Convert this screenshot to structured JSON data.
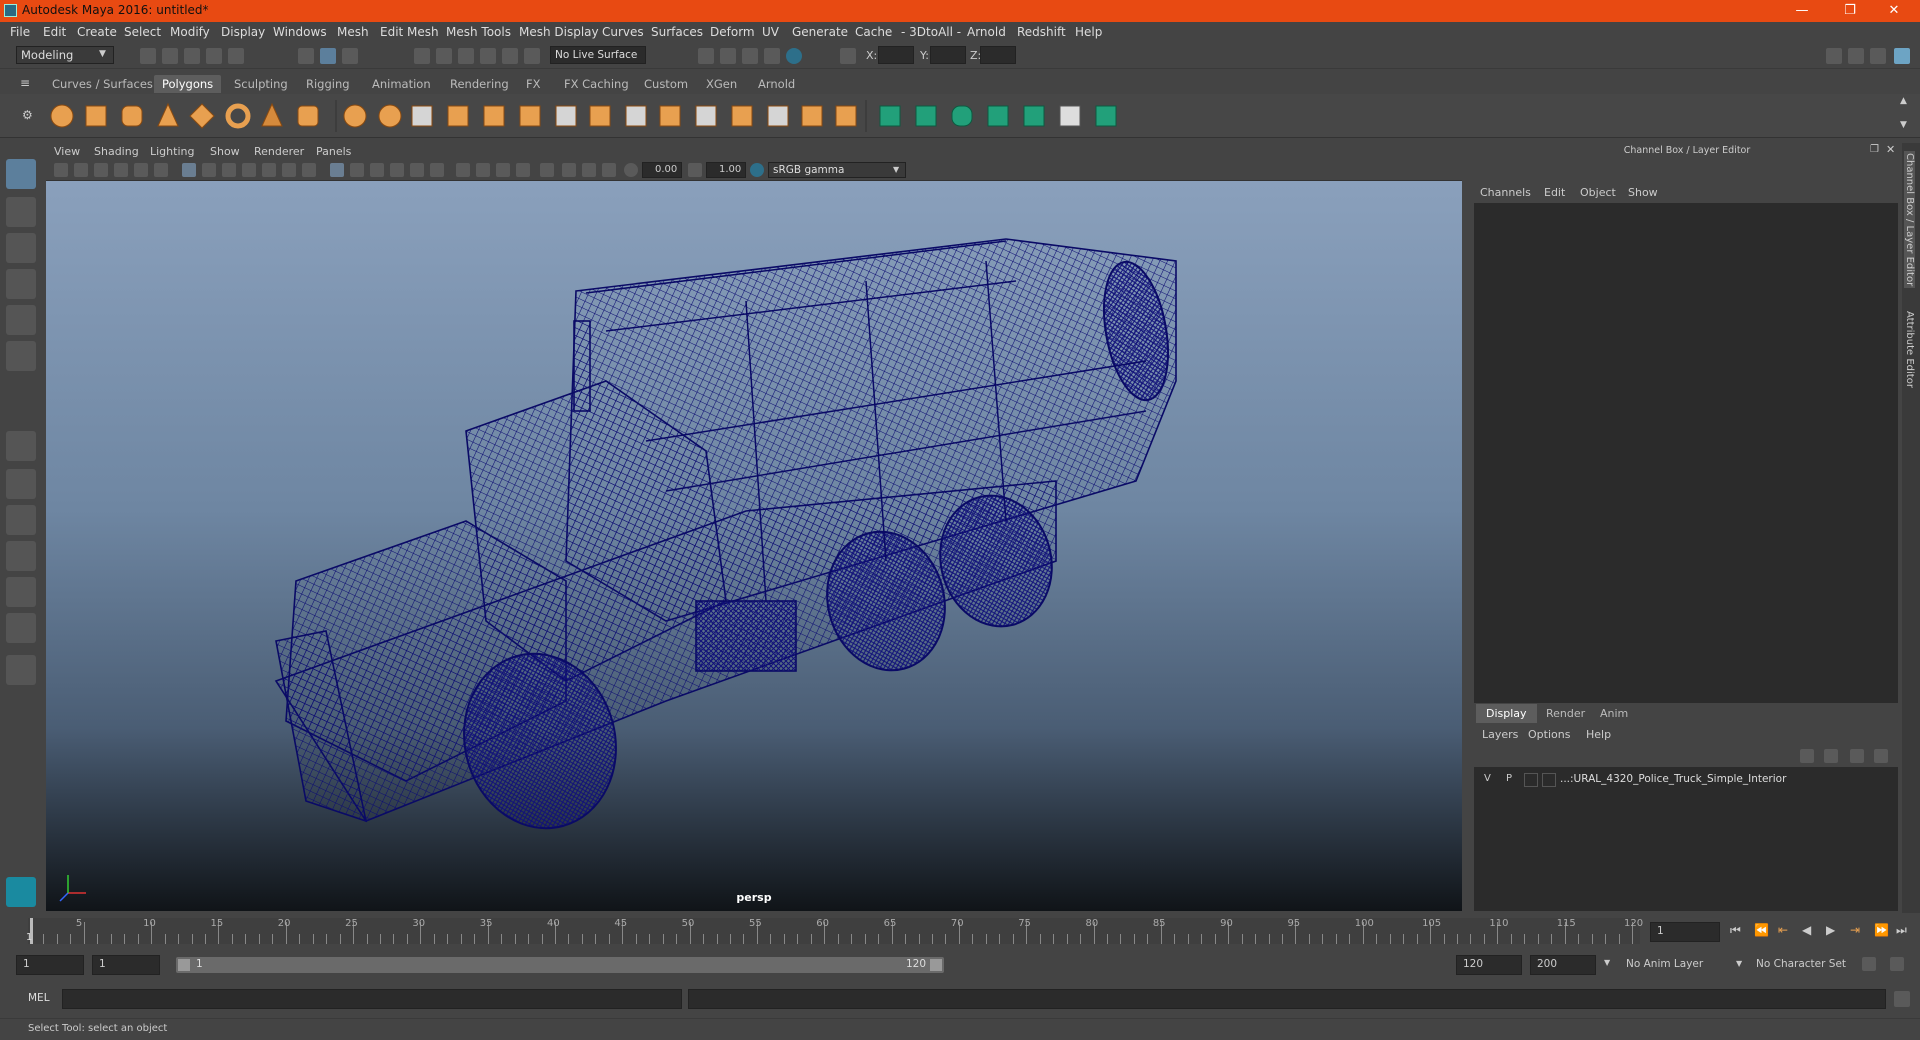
{
  "window": {
    "title": "Autodesk Maya 2016: untitled*",
    "minimize": "—",
    "restore": "❐",
    "close": "✕"
  },
  "menubar": [
    "File",
    "Edit",
    "Create",
    "Select",
    "Modify",
    "Display",
    "Windows",
    "Mesh",
    "Edit Mesh",
    "Mesh Tools",
    "Mesh Display",
    "Curves",
    "Surfaces",
    "Deform",
    "UV",
    "Generate",
    "Cache",
    "- 3DtoAll -",
    "Arnold",
    "Redshift",
    "Help"
  ],
  "statusline": {
    "mode": "Modeling",
    "live_surface": "No Live Surface",
    "x_label": "X:",
    "y_label": "Y:",
    "z_label": "Z:"
  },
  "shelf_tabs": [
    "Curves / Surfaces",
    "Polygons",
    "Sculpting",
    "Rigging",
    "Animation",
    "Rendering",
    "FX",
    "FX Caching",
    "Custom",
    "XGen",
    "Arnold"
  ],
  "shelf_active": "Polygons",
  "viewport": {
    "menu": [
      "View",
      "Shading",
      "Lighting",
      "Show",
      "Renderer",
      "Panels"
    ],
    "exposure": "0.00",
    "gamma": "1.00",
    "color_space": "sRGB gamma",
    "camera_label": "persp"
  },
  "channel_box": {
    "title": "Channel Box / Layer Editor",
    "menu": [
      "Channels",
      "Edit",
      "Object",
      "Show"
    ]
  },
  "layer_editor": {
    "tabs": [
      "Display",
      "Render",
      "Anim"
    ],
    "active_tab": "Display",
    "menu": [
      "Layers",
      "Options",
      "Help"
    ],
    "layers": [
      {
        "v": "V",
        "p": "P",
        "name": "...:URAL_4320_Police_Truck_Simple_Interior"
      }
    ]
  },
  "side_tabs": [
    "Channel Box / Layer Editor",
    "Attribute Editor"
  ],
  "timeline": {
    "ticks": [
      5,
      10,
      15,
      20,
      25,
      30,
      35,
      40,
      45,
      50,
      55,
      60,
      65,
      70,
      75,
      80,
      85,
      90,
      95,
      100,
      105,
      110,
      115,
      120
    ],
    "start_label": "1",
    "current_frame": "1"
  },
  "range": {
    "start": "1",
    "playback_start": "1",
    "slider_start": "1",
    "slider_end": "120",
    "playback_end": "120",
    "end": "200",
    "anim_layer": "No Anim Layer",
    "char_set": "No Character Set"
  },
  "mel": {
    "label": "MEL"
  },
  "help_line": "Select Tool: select an object",
  "colors": {
    "titlebar": "#e84a12",
    "wireframe": "#14147a",
    "accent": "#e8a050"
  }
}
